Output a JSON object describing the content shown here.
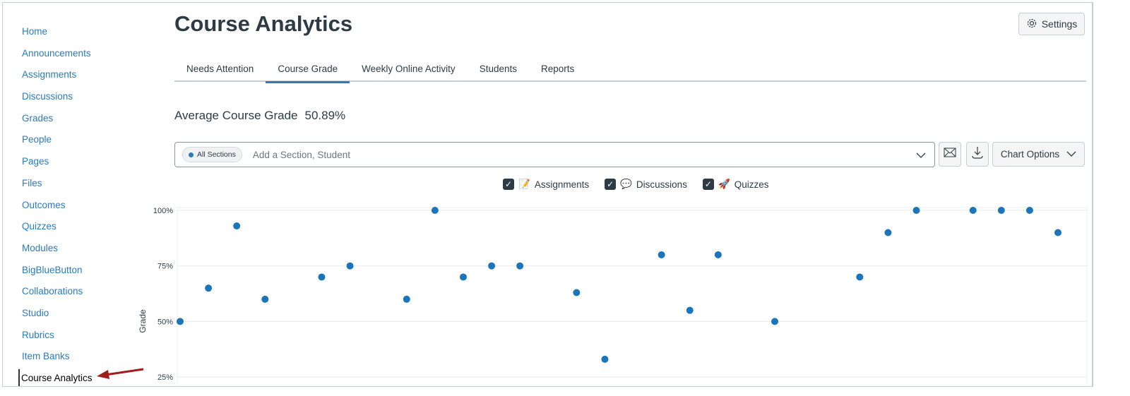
{
  "sidebar": {
    "items": [
      "Home",
      "Announcements",
      "Assignments",
      "Discussions",
      "Grades",
      "People",
      "Pages",
      "Files",
      "Outcomes",
      "Quizzes",
      "Modules",
      "BigBlueButton",
      "Collaborations",
      "Studio",
      "Rubrics",
      "Item Banks",
      "Course Analytics"
    ],
    "active": "Course Analytics"
  },
  "header": {
    "title": "Course Analytics",
    "settings_label": "Settings"
  },
  "tabs": [
    "Needs Attention",
    "Course Grade",
    "Weekly Online Activity",
    "Students",
    "Reports"
  ],
  "active_tab": "Course Grade",
  "summary": {
    "label": "Average Course Grade",
    "value": "50.89%"
  },
  "filter": {
    "pill": "All Sections",
    "placeholder": "Add a Section, Student"
  },
  "toolbar": {
    "chart_options_label": "Chart Options",
    "icons": [
      "mail-icon",
      "download-icon"
    ]
  },
  "legend": [
    "Assignments",
    "Discussions",
    "Quizzes"
  ],
  "colors": {
    "accent": "#2b7abc",
    "point": "#1a75bb",
    "annotation_arrow": "#a31c1c"
  },
  "chart_data": {
    "type": "scatter",
    "title": "",
    "ylabel": "Grade",
    "yticks": [
      "100%",
      "75%",
      "50%",
      "25%"
    ],
    "ylim": [
      25,
      100
    ],
    "x": [
      0,
      1,
      2,
      3,
      5,
      6,
      8,
      9,
      10,
      11,
      12,
      14,
      15,
      17,
      18,
      19,
      21,
      24,
      25,
      26,
      28,
      29,
      30,
      31
    ],
    "values": [
      50,
      65,
      93,
      60,
      70,
      75,
      60,
      100,
      70,
      75,
      75,
      63,
      33,
      80,
      55,
      80,
      50,
      70,
      90,
      100,
      100,
      100,
      100,
      90
    ],
    "slots": 32
  }
}
